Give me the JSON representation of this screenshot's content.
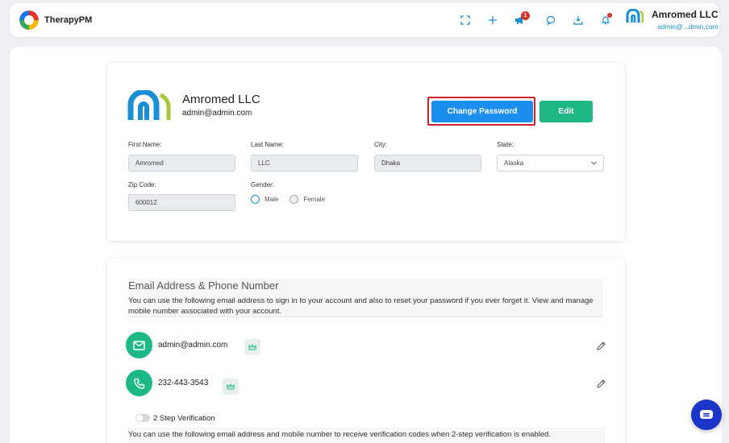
{
  "app": {
    "name": "TherapyPM"
  },
  "header": {
    "user_name": "Amromed LLC",
    "user_email": "admin@...dmin.com",
    "notification_count": "1",
    "icons": [
      "fullscreen-icon",
      "plus-icon",
      "megaphone-icon",
      "chat-icon",
      "download-icon",
      "bell-icon"
    ]
  },
  "profile": {
    "org_name": "Amromed LLC",
    "org_email": "admin@admin.com",
    "change_password_label": "Change Password",
    "edit_label": "Edit",
    "fields": {
      "first_name": {
        "label": "First Name:",
        "value": "Amromed"
      },
      "last_name": {
        "label": "Last Name:",
        "value": "LLC"
      },
      "city": {
        "label": "City:",
        "value": "Dhaka"
      },
      "state": {
        "label": "State:",
        "value": "Alaska"
      },
      "zip": {
        "label": "Zip Code:",
        "value": "600012"
      },
      "gender": {
        "label": "Gender:",
        "options": [
          "Male",
          "Female"
        ],
        "selected": "Male"
      }
    }
  },
  "contact": {
    "title": "Email Address & Phone Number",
    "description": "You can use the following email address to sign in to your account and also to reset your password if you ever forget it. View and manage mobile number associated with your account.",
    "email": "admin@admin.com",
    "phone": "232-443-3543",
    "two_step_label": "2 Step Verification",
    "two_step_description": "You can use the following email address and mobile number to receive verification codes when 2-step verification is enabled."
  },
  "colors": {
    "primary": "#1b8ff0",
    "success": "#1eb887",
    "highlight": "#c8252a",
    "chat": "#1a35c8"
  }
}
